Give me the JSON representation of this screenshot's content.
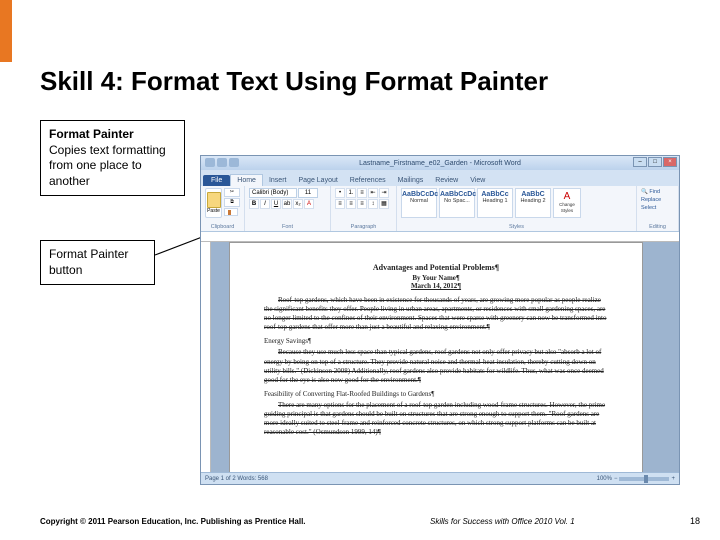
{
  "slide": {
    "title": "Skill 4: Format Text Using Format Painter",
    "callout1_title": "Format Painter",
    "callout1_body": "Copies text formatting from one place to another",
    "callout2": "Format Painter button",
    "copyright": "Copyright © 2011 Pearson Education, Inc. Publishing as Prentice Hall.",
    "footer": "Skills for Success with Office 2010 Vol. 1",
    "pagenum": "18"
  },
  "word": {
    "title": "Lastname_Firstname_e02_Garden - Microsoft Word",
    "file_tab": "File",
    "tabs": [
      "Home",
      "Insert",
      "Page Layout",
      "References",
      "Mailings",
      "Review",
      "View"
    ],
    "active_tab": 0,
    "ribbon": {
      "paste": "Paste",
      "clipboard": "Clipboard",
      "font": "Font",
      "paragraph": "Paragraph",
      "styles": "Styles",
      "editing": "Editing",
      "font_name": "Calibri (Body)",
      "font_size": "11",
      "style_preview": "AaBbCcDc",
      "style_preview2": "AaBbCc",
      "style_preview3": "AaBbC",
      "style_names": [
        "Normal",
        "No Spac...",
        "Heading 1",
        "Heading 2"
      ],
      "change_styles": "Change Styles",
      "find": "Find",
      "replace": "Replace",
      "select": "Select"
    },
    "status": {
      "left": "Page 1 of 2    Words: 568",
      "zoom": "100%"
    },
    "doc": {
      "heading": "Advantages and Potential Problems¶",
      "byline": "By Your Name¶",
      "date": "March 14, 2012¶",
      "p1": "Roof-top gardens, which have been in existence for thousands of years, are growing more popular as people realize the significant benefits they offer. People living in urban areas, apartments, or residences with small gardening spaces, are no longer limited to the confines of their environment. Spaces that were sparse with greenery can now be transformed into roof-top gardens that offer more than just a beautiful and relaxing environment.¶",
      "sub1": "Energy Savings¶",
      "p2": "Because they use much less space than typical gardens, roof gardens not only offer privacy but also \"absorb a lot of energy by being on top of a structure. They provide natural noise and thermal-heat insulation, thereby cutting down on utility bills.\" (Dickinson 2008) Additionally, roof gardens also provide habitats for wildlife. Thus, what was once deemed good for the eye is also now good for the environment.¶",
      "sub2": "Feasibility of Converting Flat-Roofed Buildings to Gardens¶",
      "p3": "There are many options for the placement of a roof-top garden including wood-frame structures. However, the prime guiding principal is that gardens should be built on structures that are strong enough to support them. \"Roof gardens are more ideally suited to steel-frame and reinforced concrete structures, on which strong support platforms can be built at reasonable cost.\" (Osmundson 1999, 14)¶"
    }
  }
}
